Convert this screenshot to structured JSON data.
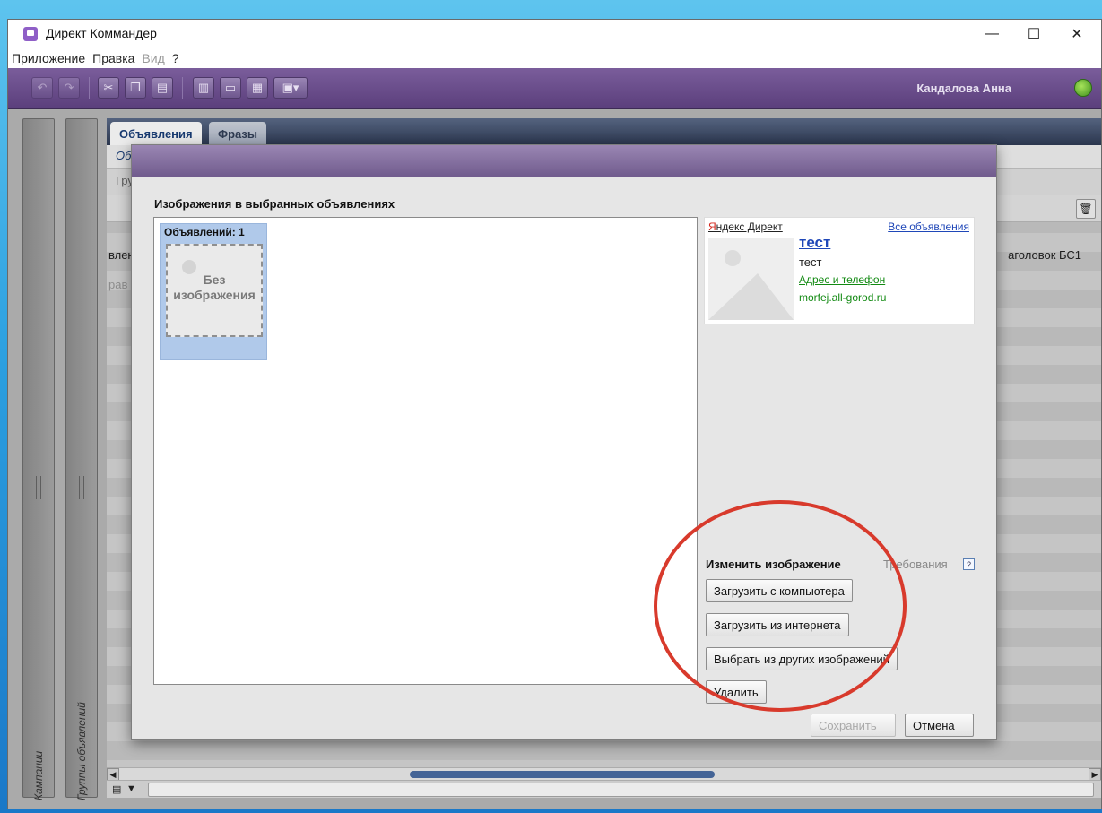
{
  "window": {
    "title": "Директ Коммандер",
    "minimize": "—",
    "maximize": "☐",
    "close": "✕"
  },
  "menu": [
    "Приложение",
    "Правка",
    "Вид",
    "?"
  ],
  "toolbar": {
    "user": "Кандалова Анна"
  },
  "sidebar": {
    "campaigns": "Кампании",
    "groups": "Группы объявлений"
  },
  "tabs": {
    "ads": "Объявления",
    "phrases": "Фразы"
  },
  "background": {
    "subbar": "Об",
    "filter": "Гру",
    "col_left": "влен",
    "col_left2": "рав",
    "col_right": "аголовок БС1"
  },
  "dialog": {
    "heading": "Изображения в выбранных объявлениях",
    "item_label": "Объявлений: 1",
    "no_image_line1": "Без",
    "no_image_line2": "изображения",
    "preview": {
      "brand_first": "Я",
      "brand_rest": "ндекс Директ",
      "all_ads": "Все объявления",
      "title": "тест",
      "text": "тест",
      "address": "Адрес и телефон",
      "domain": "morfej.all-gorod.ru"
    },
    "change_label": "Изменить изображение",
    "requirements": "Требования",
    "btn_upload_pc": "Загрузить с компьютера",
    "btn_upload_web": "Загрузить из интернета",
    "btn_choose": "Выбрать из других изображений",
    "btn_delete": "Удалить",
    "btn_save": "Сохранить",
    "btn_cancel": "Отмена"
  }
}
